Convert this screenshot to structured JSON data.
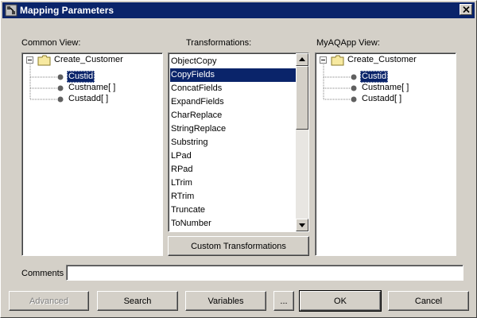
{
  "window": {
    "title": "Mapping Parameters"
  },
  "common_view": {
    "label": "Common View:",
    "root": "Create_Customer",
    "children": [
      {
        "label": "Custid",
        "selected": true
      },
      {
        "label": "Custname[ ]",
        "selected": false
      },
      {
        "label": "Custadd[ ]",
        "selected": false
      }
    ]
  },
  "transformations": {
    "label": "Transformations:",
    "items": [
      "ObjectCopy",
      "CopyFields",
      "ConcatFields",
      "ExpandFields",
      "CharReplace",
      "StringReplace",
      "Substring",
      "LPad",
      "RPad",
      "LTrim",
      "RTrim",
      "Truncate",
      "ToNumber"
    ],
    "selected_item": "CopyFields",
    "custom_button": "Custom Transformations"
  },
  "app_view": {
    "label": "MyAQApp View:",
    "root": "Create_Customer",
    "children": [
      {
        "label": "Custid",
        "selected": true
      },
      {
        "label": "Custname[ ]",
        "selected": false
      },
      {
        "label": "Custadd[ ]",
        "selected": false
      }
    ]
  },
  "comments": {
    "label": "Comments",
    "value": ""
  },
  "buttons": {
    "advanced": "Advanced",
    "search": "Search",
    "variables": "Variables",
    "more": "...",
    "ok": "OK",
    "cancel": "Cancel"
  },
  "colors": {
    "titlebar": "#0a246a",
    "face": "#d4d0c8",
    "selection": "#0a246a"
  }
}
